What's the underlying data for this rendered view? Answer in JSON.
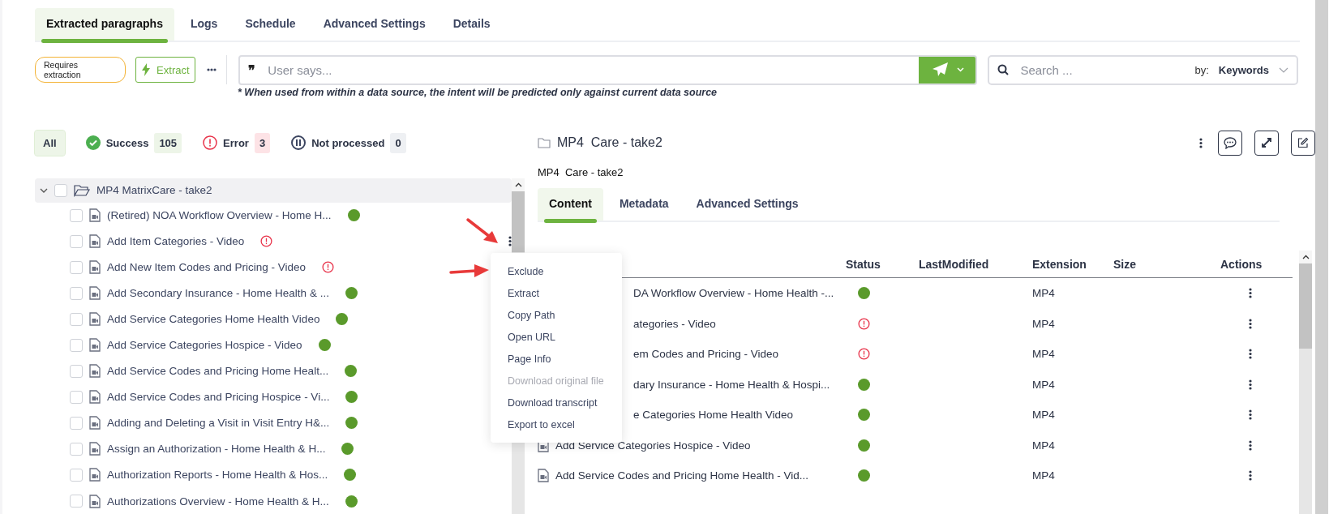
{
  "tabs": [
    {
      "label": "Extracted paragraphs",
      "selected": true
    },
    {
      "label": "Logs",
      "selected": false
    },
    {
      "label": "Schedule",
      "selected": false
    },
    {
      "label": "Advanced Settings",
      "selected": false
    },
    {
      "label": "Details",
      "selected": false
    }
  ],
  "toolbar": {
    "badge": "Requires extraction",
    "extract": "Extract",
    "user_says": {
      "quote": "❞",
      "placeholder": "User says..."
    },
    "note": "* When used from within a data source, the intent will be predicted only against current data source",
    "search": {
      "placeholder": "Search ...",
      "by_label": "by:",
      "by_value": "Keywords"
    }
  },
  "filters": [
    {
      "kind": "all",
      "label": "All",
      "selected": true
    },
    {
      "kind": "success",
      "label": "Success",
      "count": "105",
      "selected": false
    },
    {
      "kind": "error",
      "label": "Error",
      "count": "3",
      "selected": false
    },
    {
      "kind": "paused",
      "label": "Not processed",
      "count": "0",
      "selected": false
    }
  ],
  "tree": {
    "label": "MP4 MatrixCare - take2",
    "expanded": true,
    "checked": false,
    "children": [
      {
        "label": "(Retired) NOA Workflow Overview - Home H...",
        "kind": "success",
        "checked": false,
        "menu_open": false
      },
      {
        "label": "Add Item Categories - Video",
        "kind": "error",
        "checked": false,
        "menu_open": true
      },
      {
        "label": "Add New Item Codes and Pricing - Video",
        "kind": "error",
        "checked": false,
        "menu_open": false
      },
      {
        "label": "Add Secondary Insurance - Home Health & ...",
        "kind": "success",
        "checked": false,
        "menu_open": false
      },
      {
        "label": "Add Service Categories Home Health Video",
        "kind": "success",
        "checked": false,
        "menu_open": false
      },
      {
        "label": "Add Service Categories Hospice - Video",
        "kind": "success",
        "checked": false,
        "menu_open": false
      },
      {
        "label": "Add Service Codes and Pricing Home Healt...",
        "kind": "success",
        "checked": false,
        "menu_open": false
      },
      {
        "label": "Add Service Codes and Pricing Hospice - Vi...",
        "kind": "success",
        "checked": false,
        "menu_open": false
      },
      {
        "label": "Adding and Deleting a Visit in Visit Entry H&...",
        "kind": "success",
        "checked": false,
        "menu_open": false
      },
      {
        "label": "Assign an Authorization - Home Health & H...",
        "kind": "success",
        "checked": false,
        "menu_open": false
      },
      {
        "label": "Authorization Reports - Home Health & Hos...",
        "kind": "success",
        "checked": false,
        "menu_open": false
      },
      {
        "label": "Authorizations Overview - Home Health & H...",
        "kind": "success",
        "checked": false,
        "menu_open": false
      }
    ]
  },
  "context_menu": [
    {
      "label": "Exclude",
      "disabled": false
    },
    {
      "label": "Extract",
      "disabled": false
    },
    {
      "label": "Copy Path",
      "disabled": false
    },
    {
      "label": "Open URL",
      "disabled": false
    },
    {
      "label": "Page Info",
      "disabled": false
    },
    {
      "label": "Download original file",
      "disabled": true
    },
    {
      "label": "Download transcript",
      "disabled": false
    },
    {
      "label": "Export to excel",
      "disabled": false
    }
  ],
  "detail": {
    "title": "MP4  Care - take2",
    "subtitle": "MP4  Care - take2",
    "tabs": [
      {
        "label": "Content",
        "selected": true
      },
      {
        "label": "Metadata",
        "selected": false
      },
      {
        "label": "Advanced Settings",
        "selected": false
      }
    ],
    "table": {
      "columns": [
        "Status",
        "LastModified",
        "Extension",
        "Size",
        "Actions"
      ],
      "rows": [
        {
          "covered": true,
          "name": "DA Workflow Overview - Home Health -...",
          "kind": "success",
          "extension": "MP4"
        },
        {
          "covered": true,
          "name": "ategories - Video",
          "kind": "error",
          "extension": "MP4"
        },
        {
          "covered": true,
          "name": "em Codes and Pricing - Video",
          "kind": "error",
          "extension": "MP4"
        },
        {
          "covered": true,
          "name": "dary Insurance - Home Health & Hospi...",
          "kind": "success",
          "extension": "MP4"
        },
        {
          "covered": true,
          "name": "e Categories Home Health Video",
          "kind": "success",
          "extension": "MP4"
        },
        {
          "covered": false,
          "name": "Add Service Categories Hospice - Video",
          "kind": "success",
          "extension": "MP4"
        },
        {
          "covered": false,
          "name": "Add Service Codes and Pricing Home Health - Vid...",
          "kind": "success",
          "extension": "MP4"
        }
      ]
    }
  }
}
